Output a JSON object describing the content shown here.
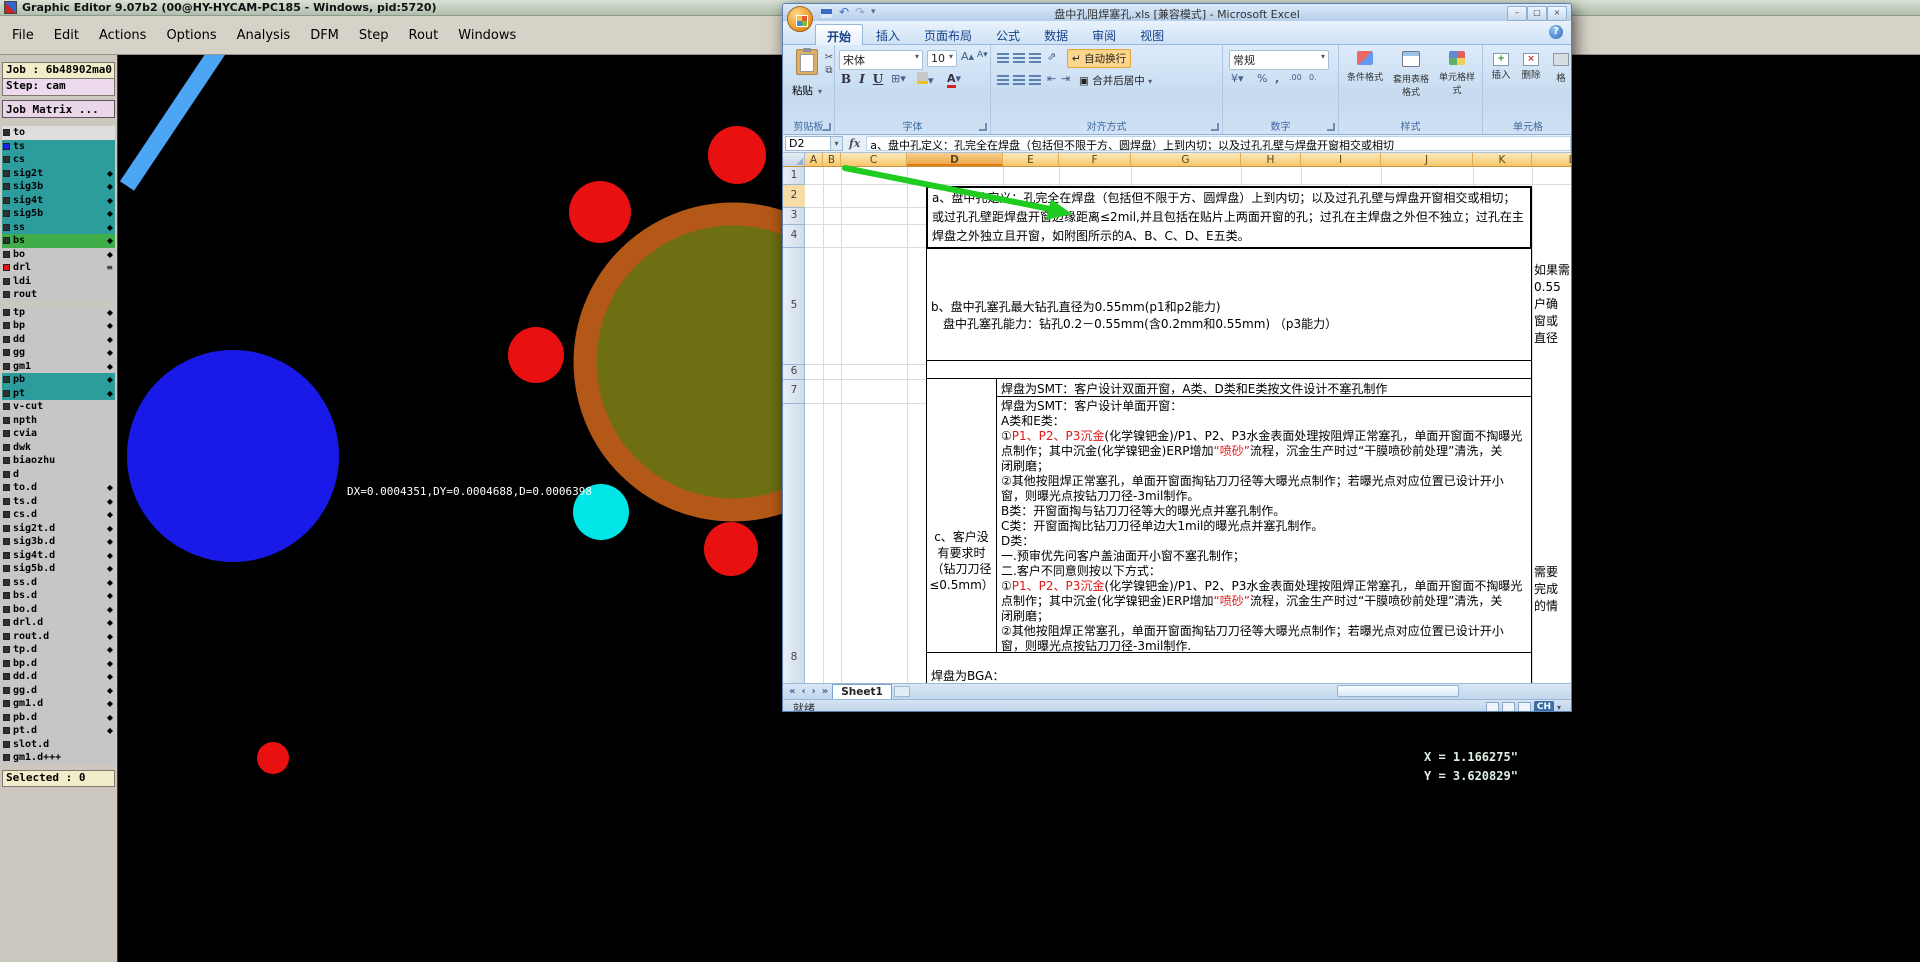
{
  "cam": {
    "title": "Graphic Editor 9.07b2 (00@HY-HYCAM-PC185 - Windows, pid:5720)",
    "menus": [
      "File",
      "Edit",
      "Actions",
      "Options",
      "Analysis",
      "DFM",
      "Step",
      "Rout",
      "Windows"
    ],
    "job_label": "Job : 6b48902ma0",
    "step_label": "Step: cam",
    "matrix_label": "Job Matrix ...",
    "selected_label": "Selected : 0",
    "measurement_text": "DX=0.0004351,DY=0.0004688,D=0.0006398",
    "coord_x": "X = 1.166275\"",
    "coord_y": "Y = 3.620829\"",
    "palette": {
      "red": "#e81010",
      "blue_pad": "#1a1ae8",
      "cyan": "#00e6e6",
      "olive": "#6e6e12",
      "ring": "#b45818",
      "sky_line": "#4da6f5",
      "arrow_green": "#1fcc1f"
    },
    "layers": [
      {
        "n": "to",
        "bg": "light"
      },
      {
        "n": "ts",
        "bg": "teal",
        "chip": "#2222e8"
      },
      {
        "n": "cs",
        "bg": "teal"
      },
      {
        "n": "sig2t",
        "bg": "teal",
        "m": "◆"
      },
      {
        "n": "sig3b",
        "bg": "teal",
        "m": "◆"
      },
      {
        "n": "sig4t",
        "bg": "teal",
        "m": "◆"
      },
      {
        "n": "sig5b",
        "bg": "teal",
        "m": "◆"
      },
      {
        "n": "ss",
        "bg": "teal",
        "m": "◆"
      },
      {
        "n": "bs",
        "bg": "green",
        "m": "◆"
      },
      {
        "n": "bo",
        "bg": "gray",
        "m": "◆"
      },
      {
        "n": "drl",
        "bg": "gray",
        "chip": "#e01818",
        "m": "≡"
      },
      {
        "n": "ldi",
        "bg": "gray"
      },
      {
        "n": "rout",
        "bg": "gray"
      },
      {
        "n": "tp",
        "bg": "gray",
        "m": "◆",
        "gap": true
      },
      {
        "n": "bp",
        "bg": "gray",
        "m": "◆"
      },
      {
        "n": "dd",
        "bg": "gray",
        "m": "◆"
      },
      {
        "n": "gg",
        "bg": "gray",
        "m": "◆"
      },
      {
        "n": "gm1",
        "bg": "gray",
        "m": "◆"
      },
      {
        "n": "pb",
        "bg": "teal",
        "m": "◆"
      },
      {
        "n": "pt",
        "bg": "teal",
        "m": "◆"
      },
      {
        "n": "v-cut",
        "bg": "gray"
      },
      {
        "n": "npth",
        "bg": "gray"
      },
      {
        "n": "cvia",
        "bg": "gray"
      },
      {
        "n": "dwk",
        "bg": "gray"
      },
      {
        "n": "biaozhu",
        "bg": "gray"
      },
      {
        "n": "d",
        "bg": "gray"
      },
      {
        "n": "to.d",
        "bg": "gray",
        "m": "◆"
      },
      {
        "n": "ts.d",
        "bg": "gray",
        "m": "◆"
      },
      {
        "n": "cs.d",
        "bg": "gray",
        "m": "◆"
      },
      {
        "n": "sig2t.d",
        "bg": "gray",
        "m": "◆"
      },
      {
        "n": "sig3b.d",
        "bg": "gray",
        "m": "◆"
      },
      {
        "n": "sig4t.d",
        "bg": "gray",
        "m": "◆"
      },
      {
        "n": "sig5b.d",
        "bg": "gray",
        "m": "◆"
      },
      {
        "n": "ss.d",
        "bg": "gray",
        "m": "◆"
      },
      {
        "n": "bs.d",
        "bg": "gray",
        "m": "◆"
      },
      {
        "n": "bo.d",
        "bg": "gray",
        "m": "◆"
      },
      {
        "n": "drl.d",
        "bg": "gray",
        "m": "◆"
      },
      {
        "n": "rout.d",
        "bg": "gray",
        "m": "◆"
      },
      {
        "n": "tp.d",
        "bg": "gray",
        "m": "◆"
      },
      {
        "n": "bp.d",
        "bg": "gray",
        "m": "◆"
      },
      {
        "n": "dd.d",
        "bg": "gray",
        "m": "◆"
      },
      {
        "n": "gg.d",
        "bg": "gray",
        "m": "◆"
      },
      {
        "n": "gm1.d",
        "bg": "gray",
        "m": "◆"
      },
      {
        "n": "pb.d",
        "bg": "gray",
        "m": "◆"
      },
      {
        "n": "pt.d",
        "bg": "gray",
        "m": "◆"
      },
      {
        "n": "slot.d",
        "bg": "gray"
      },
      {
        "n": "gm1.d+++",
        "bg": "gray"
      }
    ]
  },
  "excel": {
    "title": "盘中孔阻焊塞孔.xls [兼容模式] - Microsoft Excel",
    "tabs": [
      "开始",
      "插入",
      "页面布局",
      "公式",
      "数据",
      "审阅",
      "视图"
    ],
    "active_tab": "开始",
    "ribbon": {
      "paste": "粘贴",
      "font_name": "宋体",
      "font_size": "10",
      "wrap_text": "自动换行",
      "merge_center": "合并后居中",
      "number_format": "常规",
      "styles": [
        "条件格式",
        "套用表格格式",
        "单元格样式"
      ],
      "cells_buttons": [
        "插入",
        "删除",
        "格"
      ],
      "group_labels": [
        "剪贴板",
        "字体",
        "对齐方式",
        "数字",
        "样式",
        "单元格"
      ]
    },
    "name_box": "D2",
    "formula": "a、盘中孔定义：孔完全在焊盘（包括但不限于方、圆焊盘）上到内切；以及过孔孔壁与焊盘开窗相交或相切",
    "columns": [
      "A",
      "B",
      "C",
      "D",
      "E",
      "F",
      "G",
      "H",
      "I",
      "J",
      "K",
      "L"
    ],
    "rows": [
      "1",
      "2",
      "3",
      "4",
      "5",
      "6",
      "7",
      "8"
    ],
    "cells": {
      "a_def": "a、盘中孔定义：孔完全在焊盘（包括但不限于方、圆焊盘）上到内切；以及过孔孔壁与焊盘开窗相交或相切；或过孔孔壁距焊盘开窗边缘距离≤2mil,并且包括在贴片上两面开窗的孔；过孔在主焊盘之外但不独立；过孔在主焊盘之外独立且开窗，如附图所示的A、B、C、D、E五类。",
      "b_line1": "b、盘中孔塞孔最大钻孔直径为0.55mm(p1和p2能力)",
      "b_line2": "　盘中孔塞孔能力：钻孔0.2－0.55mm(含0.2mm和0.55mm) （p3能力）",
      "smt_double": "焊盘为SMT：客户设计双面开窗，A类、D类和E类按文件设计不塞孔制作",
      "c_label": "c、客户没有要求时（钻刀刀径≤0.5mm）",
      "c_lines": [
        [
          {
            "t": "焊盘为SMT：客户设计单面开窗："
          }
        ],
        [
          {
            "t": "A类和E类："
          }
        ],
        [
          {
            "t": "①"
          },
          {
            "t": "P1、P2、P3沉金",
            "c": "red"
          },
          {
            "t": "(化学镍钯金)/P1、P2、P3水金表面处理按阻焊正常塞孔，单面开窗面不掏曝光"
          }
        ],
        [
          {
            "t": "点制作；其中沉金(化学镍钯金)ERP增加"
          },
          {
            "t": "“喷砂”",
            "c": "red"
          },
          {
            "t": "流程，沉金生产时过“干膜喷砂前处理”清洗，关"
          }
        ],
        [
          {
            "t": "闭刷磨；"
          }
        ],
        [
          {
            "t": "②其他按阻焊正常塞孔，单面开窗面掏钻刀刀径等大曝光点制作；若曝光点对应位置已设计开小"
          }
        ],
        [
          {
            "t": "窗，则曝光点按钻刀刀径-3mil制作。"
          }
        ],
        [
          {
            "t": "B类：开窗面掏与钻刀刀径等大的曝光点并塞孔制作。"
          }
        ],
        [
          {
            "t": "C类：开窗面掏比钻刀刀径单边大1mil的曝光点并塞孔制作。"
          }
        ],
        [
          {
            "t": "D类："
          }
        ],
        [
          {
            "t": "一.预审优先问客户盖油面开小窗不塞孔制作；"
          }
        ],
        [
          {
            "t": "二.客户不同意则按以下方式："
          }
        ],
        [
          {
            "t": "①"
          },
          {
            "t": "P1、P2、P3沉金",
            "c": "red"
          },
          {
            "t": "(化学镍钯金)/P1、P2、P3水金表面处理按阻焊正常塞孔，单面开窗面不掏曝光"
          }
        ],
        [
          {
            "t": "点制作；其中沉金(化学镍钯金)ERP增加"
          },
          {
            "t": "“喷砂”",
            "c": "red"
          },
          {
            "t": "流程，沉金生产时过“干膜喷砂前处理”清洗，关"
          }
        ],
        [
          {
            "t": "闭刷磨；"
          }
        ],
        [
          {
            "t": "②其他按阻焊正常塞孔，单面开窗面掏钻刀刀径等大曝光点制作；若曝光点对应位置已设计开小"
          }
        ],
        [
          {
            "t": "窗，则曝光点按钻刀刀径-3mil制作."
          }
        ]
      ],
      "bga": "焊盘为BGA：",
      "right_fragments_top": [
        "如果需",
        "0.55",
        "户确",
        "窗或",
        "直径"
      ],
      "right_fragments_bottom": [
        "需要",
        "完成",
        "的情"
      ]
    },
    "sheet_tab": "Sheet1",
    "status": "就绪",
    "lang_badge": "CH"
  }
}
